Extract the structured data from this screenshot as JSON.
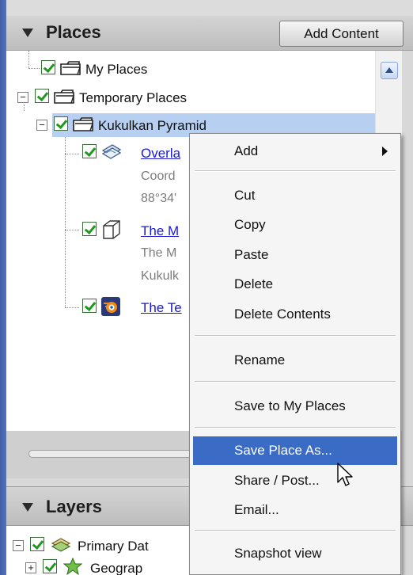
{
  "places_panel": {
    "title": "Places",
    "add_content_label": "Add Content"
  },
  "tree": {
    "my_places": "My Places",
    "temporary_places": "Temporary Places",
    "kukulkan": "Kukulkan Pyramid",
    "overlay": {
      "label": "Overla",
      "sub1": "Coord",
      "sub2": "88°34'"
    },
    "model": {
      "label": "The M",
      "sub1": "The M",
      "sub2": "Kukulk"
    },
    "tour": {
      "label": "The Te"
    }
  },
  "layers_panel": {
    "title": "Layers",
    "primary": "Primary Dat",
    "geographic": "Geograp"
  },
  "context_menu": {
    "add": "Add",
    "cut": "Cut",
    "copy": "Copy",
    "paste": "Paste",
    "delete": "Delete",
    "delete_contents": "Delete Contents",
    "rename": "Rename",
    "save_to_my_places": "Save to My Places",
    "save_place_as": "Save Place As...",
    "share_post": "Share / Post...",
    "email": "Email...",
    "snapshot_view": "Snapshot view"
  },
  "colors": {
    "selection": "#b7d0f2",
    "menu_highlight": "#3a6cc6",
    "link": "#1a1acc",
    "checkbox_check": "#1f9a1f"
  }
}
